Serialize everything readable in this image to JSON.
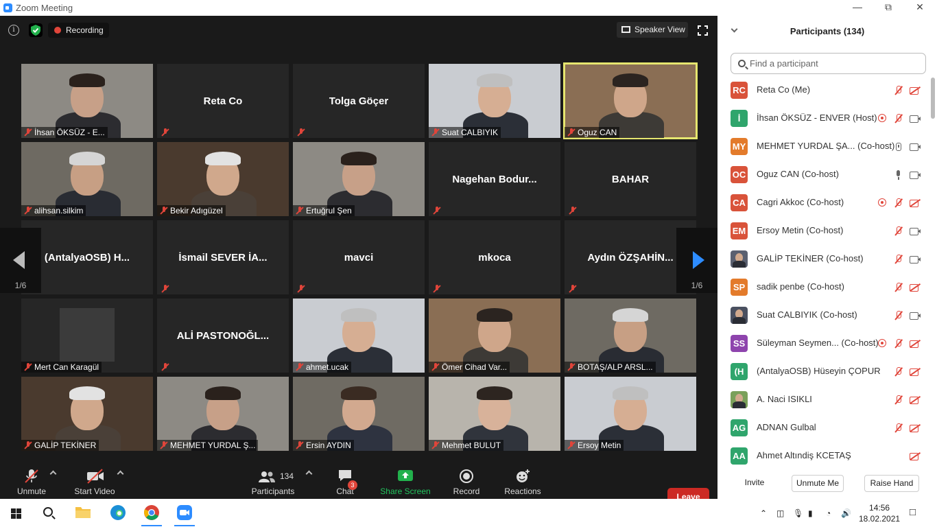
{
  "window": {
    "title": "Zoom Meeting"
  },
  "topbar": {
    "recording_label": "Recording",
    "view_label": "Speaker View"
  },
  "gallery": {
    "page_left": "1/6",
    "page_right": "1/6",
    "tiles": [
      {
        "name": "İhsan ÖKSÜZ - E...",
        "video": true
      },
      {
        "name": "Reta Co",
        "video": false
      },
      {
        "name": "Tolga Göçer",
        "video": false
      },
      {
        "name": "Suat CALBIYIK",
        "video": true
      },
      {
        "name": "Oguz CAN",
        "video": true,
        "active": true
      },
      {
        "name": "alihsan.silkim",
        "video": true
      },
      {
        "name": "Bekir Adıgüzel",
        "video": true
      },
      {
        "name": "Ertuğrul Şen",
        "video": true
      },
      {
        "name": "Nagehan  Bodur...",
        "video": false
      },
      {
        "name": "BAHAR",
        "video": false
      },
      {
        "name": "(AntalyaOSB)  H...",
        "video": false
      },
      {
        "name": "İsmail SEVER İA...",
        "video": false
      },
      {
        "name": "mavci",
        "video": false
      },
      {
        "name": "mkoca",
        "video": false
      },
      {
        "name": "Aydın  ÖZŞAHİN...",
        "video": false
      },
      {
        "name": "Mert Can Karagül",
        "video": true,
        "placeholder": true
      },
      {
        "name": "ALİ  PASTONOĞL...",
        "video": false
      },
      {
        "name": "ahmet.ucak",
        "video": true
      },
      {
        "name": "Ömer Cihad Var...",
        "video": true
      },
      {
        "name": "BOTAŞ/ALP ARSL...",
        "video": true
      },
      {
        "name": "GALİP TEKİNER",
        "video": true
      },
      {
        "name": "MEHMET YURDAL Ş...",
        "video": true
      },
      {
        "name": "Ersin AYDIN",
        "video": true
      },
      {
        "name": "Mehmet BULUT",
        "video": true
      },
      {
        "name": "Ersoy Metin",
        "video": true
      }
    ]
  },
  "toolbar": {
    "unmute": "Unmute",
    "start_video": "Start Video",
    "participants": "Participants",
    "participants_count": "134",
    "chat": "Chat",
    "chat_badge": "3",
    "share": "Share Screen",
    "record": "Record",
    "reactions": "Reactions",
    "leave": "Leave"
  },
  "panel": {
    "title": "Participants (134)",
    "search_placeholder": "Find a participant",
    "participants": [
      {
        "initials": "RC",
        "color": "#d9533a",
        "name": "Reta Co (Me)",
        "mic": "off",
        "video": "off"
      },
      {
        "initials": "İ",
        "color": "#2fa56c",
        "name": "İhsan ÖKSÜZ - ENVER (Host)",
        "rec": true,
        "mic": "off",
        "video": "on"
      },
      {
        "initials": "MY",
        "color": "#e37b2b",
        "name": "MEHMET YURDAL ŞA...  (Co-host)",
        "mic": "rec",
        "video": "on"
      },
      {
        "initials": "OC",
        "color": "#d9533a",
        "name": "Oguz CAN (Co-host)",
        "mic": "on",
        "video": "on"
      },
      {
        "initials": "CA",
        "color": "#d9533a",
        "name": "Cagri Akkoc (Co-host)",
        "rec": true,
        "mic": "off",
        "video": "off"
      },
      {
        "initials": "EM",
        "color": "#d9533a",
        "name": "Ersoy Metin (Co-host)",
        "mic": "off",
        "video": "on"
      },
      {
        "initials": "",
        "color": "#5a6070",
        "name": "GALİP TEKİNER (Co-host)",
        "photo": true,
        "mic": "off",
        "video": "on"
      },
      {
        "initials": "SP",
        "color": "#e37b2b",
        "name": "sadik penbe (Co-host)",
        "mic": "off",
        "video": "off"
      },
      {
        "initials": "",
        "color": "#4a5060",
        "name": "Suat CALBIYIK (Co-host)",
        "photo": true,
        "mic": "off",
        "video": "on"
      },
      {
        "initials": "SS",
        "color": "#8e44ad",
        "name": "Süleyman Seymen... (Co-host)",
        "rec": true,
        "mic": "off",
        "video": "off"
      },
      {
        "initials": "(H",
        "color": "#2fa56c",
        "name": "(AntalyaOSB) Hüseyin ÇOPUR",
        "mic": "off",
        "video": "off"
      },
      {
        "initials": "",
        "color": "#7aa05a",
        "name": "A. Naci ISIKLI",
        "photo": true,
        "mic": "off",
        "video": "off"
      },
      {
        "initials": "AG",
        "color": "#2fa56c",
        "name": "ADNAN Gulbal",
        "mic": "off",
        "video": "off"
      },
      {
        "initials": "AA",
        "color": "#2fa56c",
        "name": "Ahmet Altındiş KCETAŞ",
        "mic": "none",
        "video": "off"
      }
    ],
    "invite": "Invite",
    "unmute_me": "Unmute Me",
    "raise_hand": "Raise Hand"
  },
  "taskbar": {
    "time": "14:56",
    "date": "18.02.2021"
  }
}
